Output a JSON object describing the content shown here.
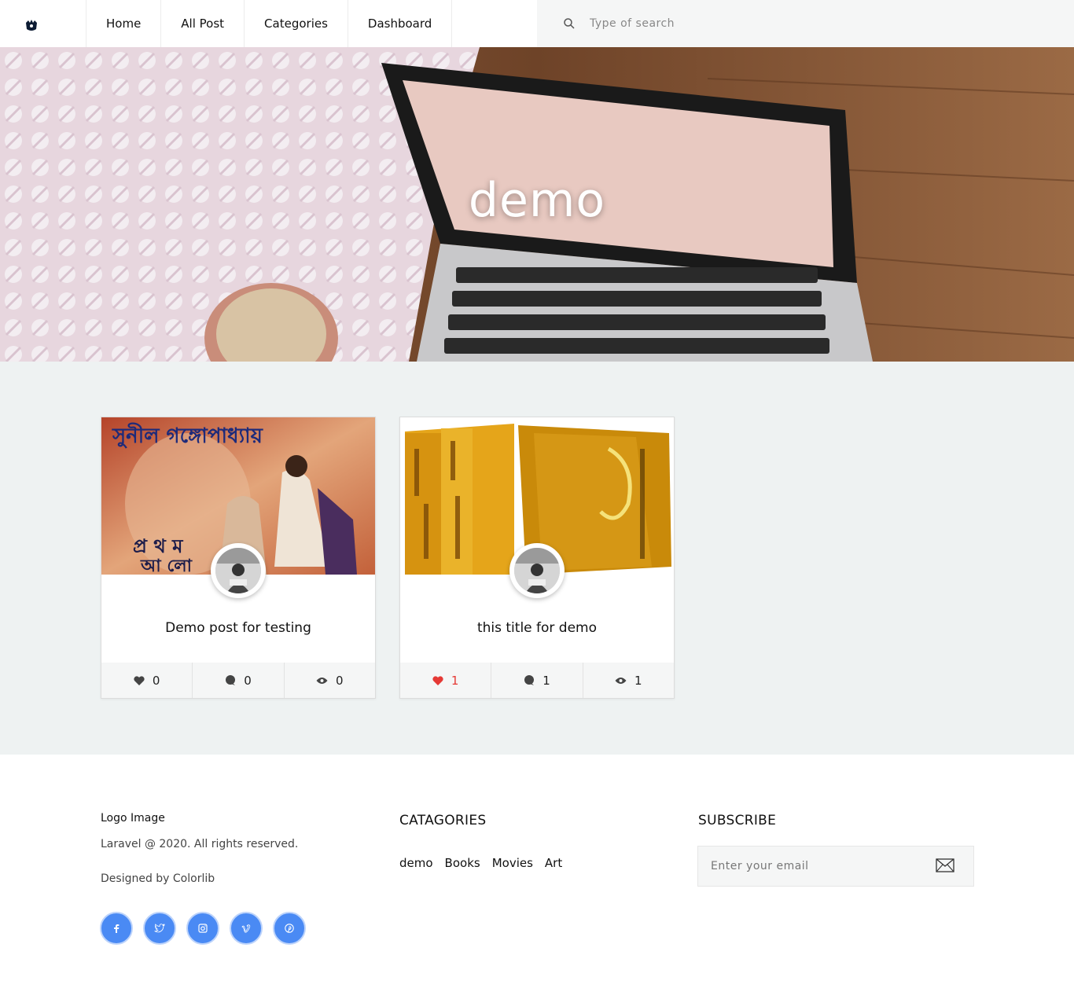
{
  "nav": {
    "items": [
      {
        "label": "Home"
      },
      {
        "label": "All Post"
      },
      {
        "label": "Categories"
      },
      {
        "label": "Dashboard"
      }
    ],
    "search_placeholder": "Type of search"
  },
  "hero": {
    "title": "demo"
  },
  "posts": [
    {
      "title": "Demo post for testing",
      "likes": "0",
      "comments": "0",
      "views": "0",
      "liked": false,
      "thumb_text_1": "সুনীল গঙ্গোপাধ্যায়",
      "thumb_text_2": "প্র থ ম",
      "thumb_text_3": "আ লো"
    },
    {
      "title": "this title for demo",
      "likes": "1",
      "comments": "1",
      "views": "1",
      "liked": true
    }
  ],
  "footer": {
    "logo_text": "Logo Image",
    "copyright": "Laravel @ 2020. All rights reserved.",
    "designed_by": "Designed by Colorlib",
    "socials": [
      "facebook",
      "twitter",
      "instagram",
      "vimeo",
      "pinterest"
    ],
    "categories_heading": "CATAGORIES",
    "categories": [
      "demo",
      "Books",
      "Movies",
      "Art"
    ],
    "subscribe_heading": "SUBSCRIBE",
    "email_placeholder": "Enter your email"
  },
  "colors": {
    "accent_blue": "#4a8af4",
    "liked_red": "#e53935",
    "section_bg": "#eef2f2"
  }
}
